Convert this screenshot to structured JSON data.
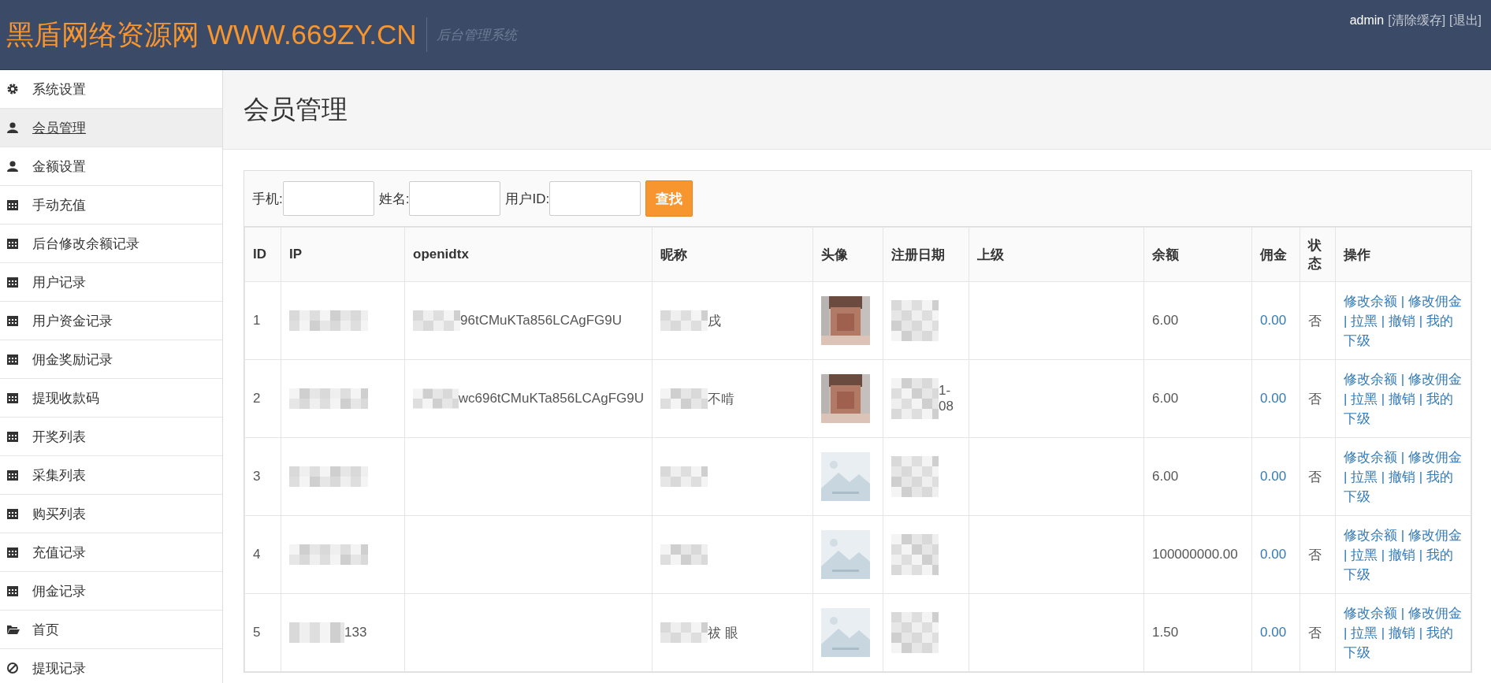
{
  "header": {
    "logo": "黑盾网络资源网 WWW.669ZY.CN",
    "subtitle": "后台管理系统",
    "user": "admin",
    "links": [
      "[清除缓存]",
      "[退出]"
    ]
  },
  "sidebar": {
    "items": [
      {
        "label": "系统设置",
        "kind": "gear",
        "selected": false
      },
      {
        "label": "会员管理",
        "kind": "user",
        "selected": true
      },
      {
        "label": "金额设置",
        "kind": "user",
        "selected": false
      },
      {
        "label": "手动充值",
        "kind": "calendar",
        "selected": false
      },
      {
        "label": "后台修改余额记录",
        "kind": "calendar",
        "selected": false
      },
      {
        "label": "用户记录",
        "kind": "calendar",
        "selected": false
      },
      {
        "label": "用户资金记录",
        "kind": "calendar",
        "selected": false
      },
      {
        "label": "佣金奖励记录",
        "kind": "calendar",
        "selected": false
      },
      {
        "label": "提现收款码",
        "kind": "calendar",
        "selected": false
      },
      {
        "label": "开奖列表",
        "kind": "calendar",
        "selected": false
      },
      {
        "label": "采集列表",
        "kind": "calendar",
        "selected": false
      },
      {
        "label": "购买列表",
        "kind": "calendar",
        "selected": false
      },
      {
        "label": "充值记录",
        "kind": "calendar",
        "selected": false
      },
      {
        "label": "佣金记录",
        "kind": "calendar",
        "selected": false
      },
      {
        "label": "首页",
        "kind": "folder",
        "selected": false
      },
      {
        "label": "提现记录",
        "kind": "ban",
        "selected": false
      }
    ]
  },
  "page_title": "会员管理",
  "search": {
    "fields": [
      {
        "label": "手机:"
      },
      {
        "label": "姓名:"
      },
      {
        "label": "用户ID:"
      }
    ],
    "button": "查找"
  },
  "table": {
    "columns": [
      "ID",
      "IP",
      "openidtx",
      "昵称",
      "头像",
      "注册日期",
      "上级",
      "余额",
      "佣金",
      "状态",
      "操作"
    ],
    "rows": [
      {
        "id": "1",
        "ip": "",
        "openidtx": "96tCMuKTa856LCAgFG9U",
        "nickname": "戌",
        "date": [],
        "balance": "6.00",
        "commission": "0.00",
        "status": "否",
        "actions": "修改余额 | 修改佣金 | 拉黑 | 撤销 | 我的下级"
      },
      {
        "id": "2",
        "ip": "",
        "openidtx": "wc696tCMuKTa856LCAgFG9U",
        "nickname": "不啃",
        "date": [
          "1-",
          "08"
        ],
        "balance": "6.00",
        "commission": "0.00",
        "status": "否",
        "actions": "修改余额 | 修改佣金 | 拉黑 | 撤销 | 我的下级"
      },
      {
        "kind": "placeholder",
        "id": "3",
        "ip": "",
        "openidtx": "",
        "nickname": "",
        "date": [],
        "balance": "6.00",
        "commission": "0.00",
        "status": "否",
        "actions": "修改余额 | 修改佣金 | 拉黑 | 撤销 | 我的下级"
      },
      {
        "kind": "placeholder",
        "id": "4",
        "ip": "",
        "openidtx": "",
        "nickname": "",
        "date": [],
        "balance": "100000000.00",
        "commission": "0.00",
        "status": "否",
        "actions": "修改余额 | 修改佣金 | 拉黑 | 撤销 | 我的下级"
      },
      {
        "kind": "placeholder",
        "id": "5",
        "ip": "133",
        "openidtx": "",
        "nickname": "祓 眼",
        "date": [],
        "balance": "1.50",
        "commission": "0.00",
        "status": "否",
        "actions": "修改余额 | 修改佣金 | 拉黑 | 撤销 | 我的下级"
      }
    ]
  }
}
